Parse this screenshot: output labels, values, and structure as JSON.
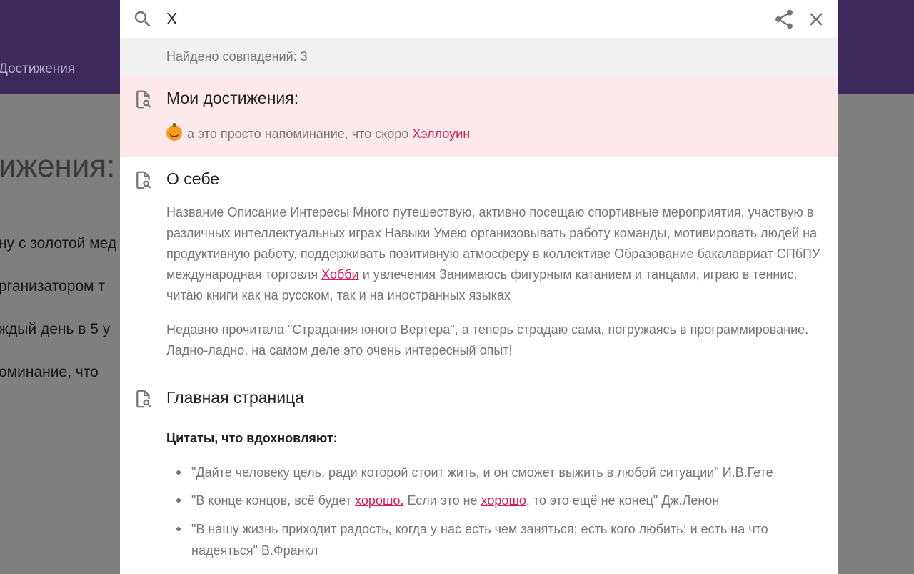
{
  "background": {
    "nav_item": "Достижения",
    "page_title": "ижения:",
    "lines": [
      "ну с золотой мед",
      "рганизатором т",
      "ждый день в 5 у",
      "оминание, что"
    ]
  },
  "search": {
    "query": "X",
    "match_count_text": "Найдено совпадений: 3",
    "icons": {
      "search": "search-icon",
      "share": "share-icon",
      "close": "close-icon",
      "document": "document-search-icon"
    }
  },
  "results": [
    {
      "title": "Мои достижения:",
      "snippet_before": "а это просто напоминание, что скоро",
      "snippet_highlight": "Хэллоуин"
    },
    {
      "title": "О себе",
      "paragraph1_before": "Название Описание Интересы Много путешествую, активно посещаю спортивные мероприятия, участвую в различных интеллектуальных играх Навыки Умею организовывать работу команды, мотивировать людей на продуктивную работу, поддерживать позитивную атмосферу в коллективе Образование бакалавриат СПбПУ международная торговля",
      "paragraph1_highlight": "Хобби",
      "paragraph1_after": "и увлечения Занимаюсь фигурным катанием и танцами, играю в теннис, читаю книги как на русском, так и на иностранных языках",
      "paragraph2": "Недавно прочитала \"Страдания юного Вертера\", а теперь страдаю сама, погружаясь в программирование. Ладно-ладно, на самом деле это очень интересный опыт!"
    },
    {
      "title": "Главная страница",
      "subheading": "Цитаты, что вдохновляют:",
      "quote1": "\"Дайте человеку цель, ради которой стоит жить, и он сможет выжить в любой ситуации\" И.В.Гете",
      "quote2_part1": "\"В конце концов, всё будет",
      "quote2_hl1": "хорошо.",
      "quote2_part2": "Если это не",
      "quote2_hl2": "хорошо",
      "quote2_part3": ", то это ещё не конец\" Дж.Ленон",
      "quote3": "\"В нашу жизнь приходит радость, когда у нас есть чем заняться; есть кого любить; и есть на что надеяться\" В.Франкл"
    }
  ],
  "colors": {
    "highlight": "#d81b60",
    "active_result_bg": "#fde8ec",
    "header_bg": "#3d2a5c"
  }
}
